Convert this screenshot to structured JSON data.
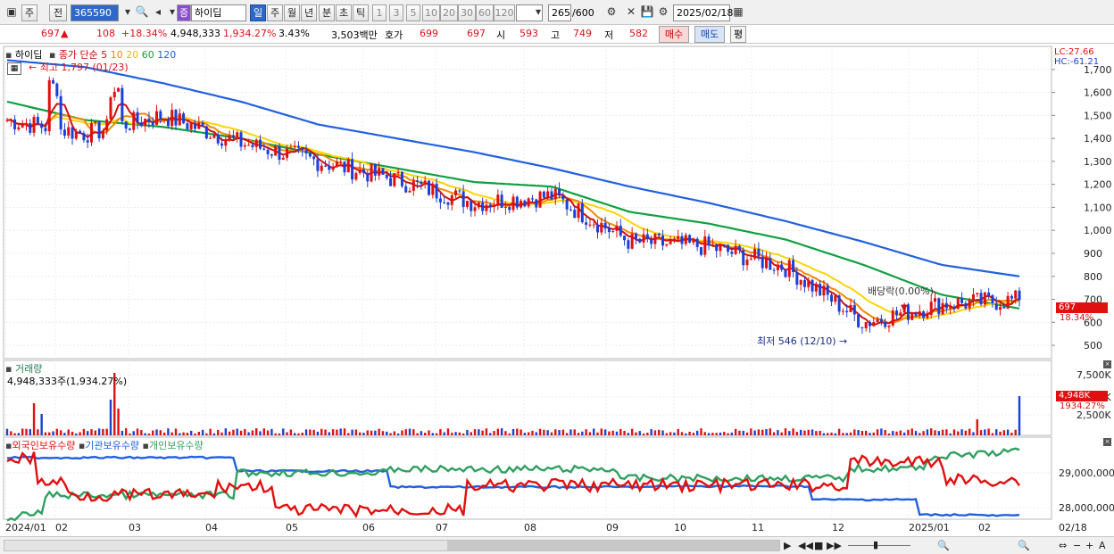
{
  "toolbar": {
    "period_day": "주",
    "period_prev": "전",
    "stock_code": "365590",
    "stock_name": "하이딥",
    "badge_icon": "증",
    "tabs": [
      "일",
      "주",
      "월",
      "년",
      "분",
      "초",
      "틱"
    ],
    "intervals": [
      "1",
      "3",
      "5",
      "10",
      "20",
      "30",
      "60",
      "120"
    ],
    "count": "265",
    "count_total": "/600",
    "date": "2025/02/18"
  },
  "quote": {
    "price": "697",
    "change": "108",
    "change_pct": "+18.34%",
    "volume": "4,948,333",
    "volume_pct": "1,934.27%",
    "turnover": "3.43%",
    "amount": "3,503백만",
    "hoga_label": "호가",
    "ask": "699",
    "bid": "697",
    "open_label": "시",
    "open": "593",
    "high_label": "고",
    "high": "749",
    "low_label": "저",
    "low": "582",
    "buy": "매수",
    "sell": "매도",
    "eval": "평"
  },
  "price_panel": {
    "name": "하이딥",
    "ma_title": "종가 단순",
    "ma_periods": [
      "5",
      "10",
      "20",
      "60",
      "120"
    ],
    "ma_colors": [
      "#d01010",
      "#f08a00",
      "#ffd400",
      "#10a040",
      "#2060e0"
    ],
    "high_annotation": "최고 1,797 (01/23)",
    "low_annotation": "최저 546 (12/10)",
    "dividend_annotation": "배당락(0.00%)",
    "lc": "LC:27.66",
    "hc": "HC:-61.21",
    "price_tag": "697",
    "pct_tag": "18.34%",
    "y_ticks": [
      "1,700",
      "1,600",
      "1,500",
      "1,400",
      "1,300",
      "1,200",
      "1,100",
      "1,000",
      "900",
      "800",
      "700",
      "600",
      "500"
    ]
  },
  "volume_panel": {
    "title": "거래량",
    "value": "4,948,333주(1,934.27%)",
    "y_ticks": [
      "7,500K",
      "5,000K",
      "2,500K"
    ],
    "tag": "4,948K",
    "tag_pct": "1934.27%"
  },
  "holding_panel": {
    "series": [
      {
        "name": "외국인보유수량",
        "color": "#e01010"
      },
      {
        "name": "기관보유수량",
        "color": "#2060e0"
      },
      {
        "name": "개인보유수량",
        "color": "#30a060"
      }
    ],
    "y_ticks": [
      "29,000,000",
      "28,000,000"
    ]
  },
  "x_axis": [
    "2024/01",
    "02",
    "03",
    "04",
    "05",
    "06",
    "07",
    "08",
    "09",
    "10",
    "11",
    "12",
    "2025/01",
    "02"
  ],
  "x_axis_right": "02/18",
  "chart_data": {
    "type": "line",
    "x": [
      "2024/01",
      "02",
      "03",
      "04",
      "05",
      "06",
      "07",
      "08",
      "09",
      "10",
      "11",
      "12",
      "2025/01",
      "02"
    ],
    "series": [
      {
        "name": "5",
        "values": [
          1480,
          1420,
          1500,
          1380,
          1300,
          1220,
          1120,
          1150,
          950,
          930,
          840,
          600,
          680,
          697
        ]
      },
      {
        "name": "60",
        "values": [
          1560,
          1480,
          1450,
          1400,
          1330,
          1270,
          1210,
          1190,
          1080,
          1030,
          960,
          850,
          720,
          660
        ]
      },
      {
        "name": "120",
        "values": [
          1740,
          1710,
          1640,
          1560,
          1460,
          1400,
          1340,
          1270,
          1190,
          1120,
          1040,
          950,
          850,
          800
        ]
      }
    ],
    "ylim": [
      450,
      1800
    ]
  }
}
